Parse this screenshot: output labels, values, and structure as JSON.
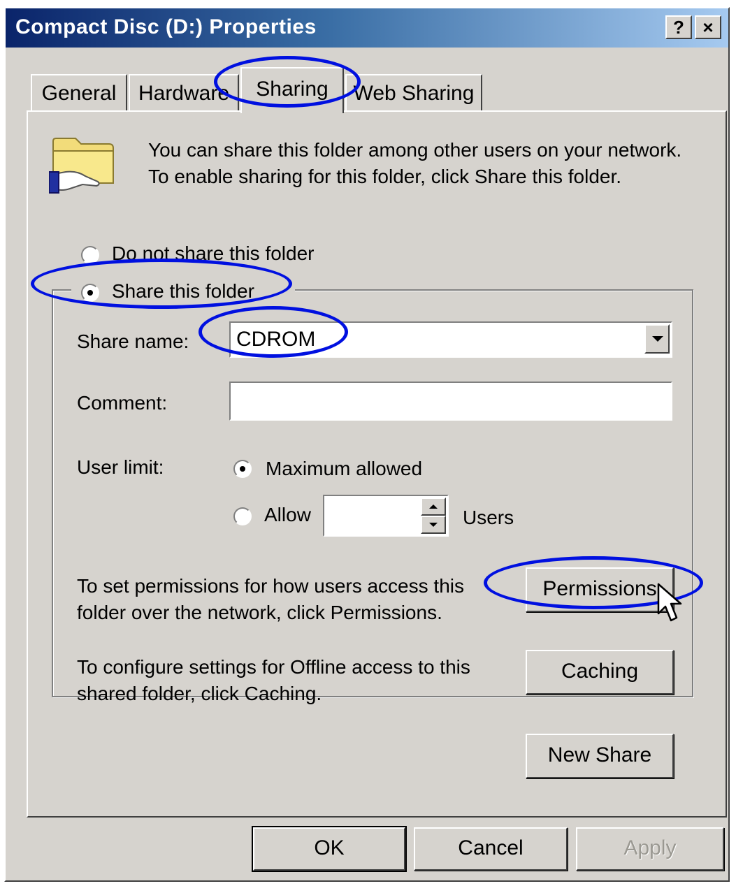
{
  "window": {
    "title": "Compact Disc (D:) Properties",
    "help_label": "?",
    "close_label": "×"
  },
  "tabs": [
    {
      "label": "General",
      "active": false
    },
    {
      "label": "Hardware",
      "active": false
    },
    {
      "label": "Sharing",
      "active": true
    },
    {
      "label": "Web Sharing",
      "active": false
    }
  ],
  "sharing": {
    "description": "You can share this folder among other users on your network.  To enable sharing for this folder, click Share this folder.",
    "do_not_share_label": "Do not share this folder",
    "share_label": "Share this folder",
    "selected_option": "share",
    "share_name_label": "Share name:",
    "share_name_value": "CDROM",
    "comment_label": "Comment:",
    "comment_value": "",
    "user_limit_label": "User limit:",
    "max_allowed_label": "Maximum allowed",
    "allow_label": "Allow",
    "allow_value": "",
    "users_label": "Users",
    "user_limit_selected": "maximum",
    "permissions_text": "To set permissions for how users access this folder over the network, click Permissions.",
    "permissions_button": "Permissions",
    "caching_text": "To configure settings for Offline access to this shared folder, click Caching.",
    "caching_button": "Caching",
    "new_share_button": "New Share"
  },
  "footer": {
    "ok_label": "OK",
    "cancel_label": "Cancel",
    "apply_label": "Apply",
    "apply_enabled": false
  },
  "annotations": {
    "color": "#0010e0",
    "highlighted": [
      "Sharing tab",
      "Share this folder",
      "CDROM",
      "Permissions"
    ]
  },
  "colors": {
    "dialog_bg": "#d6d3ce",
    "title_start": "#0a246a",
    "title_end": "#a6caf0"
  }
}
